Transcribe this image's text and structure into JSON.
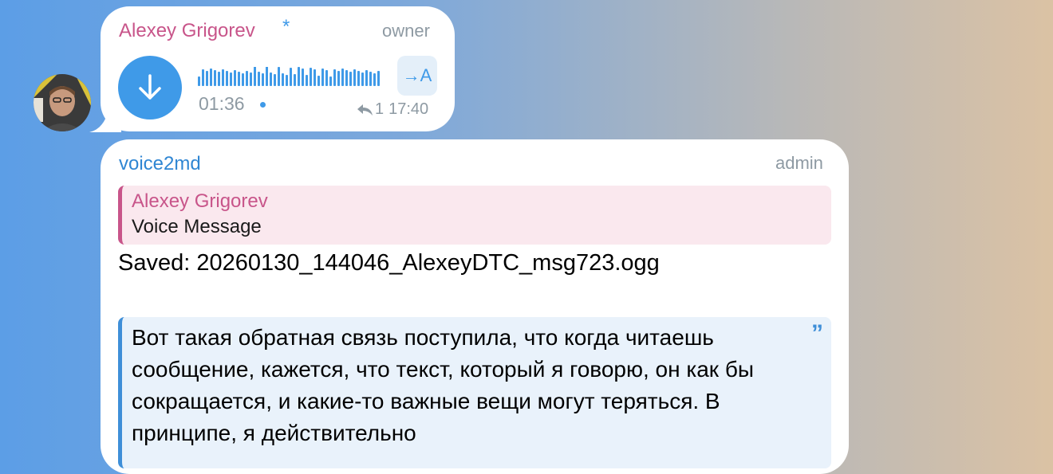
{
  "voice_message": {
    "sender": "Alexey Grigorev",
    "sender_badge": "*",
    "role": "owner",
    "duration": "01:36",
    "reply_count": "1",
    "time": "17:40",
    "translate_label": "→A",
    "icons": [
      "download-icon",
      "reply-arrow-icon",
      "translate-icon"
    ]
  },
  "bot_message": {
    "sender": "voice2md",
    "role": "admin",
    "reply": {
      "name": "Alexey Grigorev",
      "text": "Voice Message"
    },
    "saved_text": "Saved: 20260130_144046_AlexeyDTC_msg723.ogg",
    "quote_mark": "”",
    "quote_text": "Вот такая обратная связь поступила, что когда читаешь сообщение, кажется, что текст, который я говорю, он как бы сокращается, и какие-то важные вещи могут теряться. В принципе, я действительно"
  },
  "colors": {
    "accent": "#3f9ae8",
    "sender_pink": "#c8558a",
    "muted": "#8e9aa3"
  }
}
